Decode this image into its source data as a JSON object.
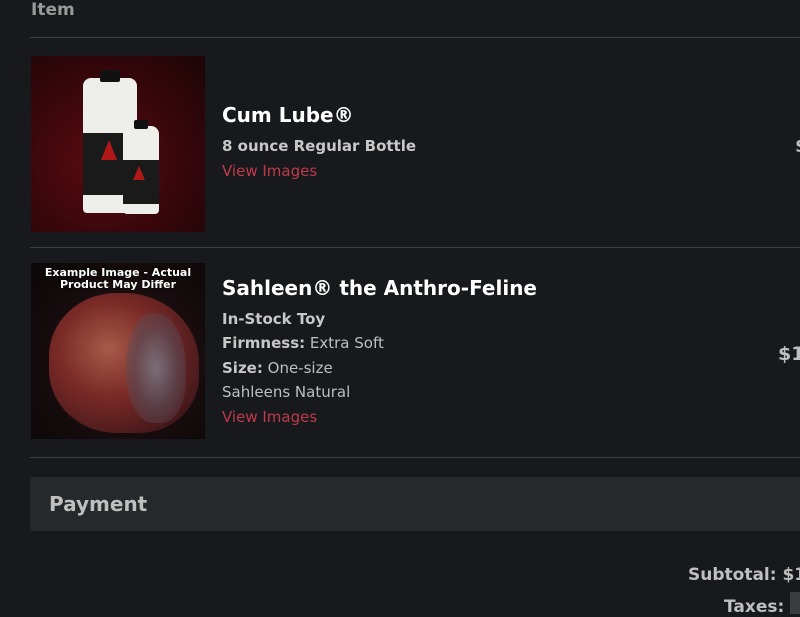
{
  "table": {
    "item_header": "Item"
  },
  "items": [
    {
      "name": "Cum Lube®",
      "details": [
        "8 ounce Regular Bottle"
      ],
      "link": "View Images",
      "price": "$"
    },
    {
      "name": "Sahleen® the Anthro-Feline",
      "image_caption": "Example Image - Actual Product May Differ",
      "details_bold": "In-Stock Toy",
      "firmness_label": "Firmness:",
      "firmness_value": "Extra Soft",
      "size_label": "Size:",
      "size_value": "One-size",
      "color": "Sahleens Natural",
      "link": "View Images",
      "price": "$1"
    }
  ],
  "payment": {
    "title": "Payment",
    "subtotal": "Subtotal: $1",
    "taxes": "Taxes:"
  },
  "colors": {
    "link": "#c0394b",
    "background": "#17191c",
    "panel": "#26282c"
  }
}
